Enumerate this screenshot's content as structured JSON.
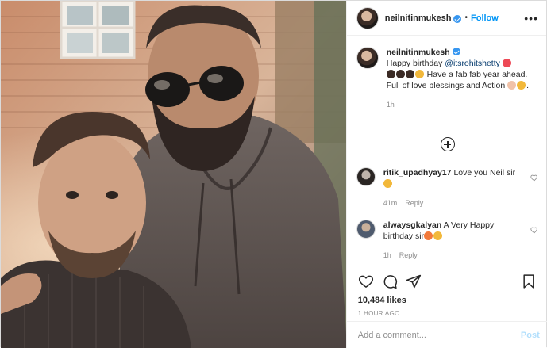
{
  "post": {
    "photo_alt": "",
    "header": {
      "username": "neilnitinmukesh",
      "separator": "•",
      "follow_label": "Follow",
      "more_icon": "more-horizontal-icon"
    },
    "caption": {
      "username": "neilnitinmukesh",
      "text_before_mention": "Happy birthday",
      "mention": "@itsrohitshetty",
      "line2": "Have a fab fab year ahead. Full of love blessings and Action",
      "line2_end": ".",
      "time": "1h"
    },
    "load_more_icon": "plus-circle-icon",
    "comments": [
      {
        "username": "ritik_upadhyay17",
        "text": "Love you Neil sir",
        "time": "41m",
        "reply_label": "Reply"
      },
      {
        "username": "alwaysgkalyan",
        "text": "A Very Happy birthday sir",
        "time": "1h",
        "reply_label": "Reply"
      }
    ],
    "likes": "10,484 likes",
    "timestamp": "1 HOUR AGO",
    "add_comment": {
      "placeholder": "Add a comment...",
      "post_label": "Post"
    },
    "colors": {
      "accent": "#0095f6",
      "heart": "#ed4956",
      "muted": "#8e8e8e",
      "post_disabled": "#b2dffc"
    }
  }
}
